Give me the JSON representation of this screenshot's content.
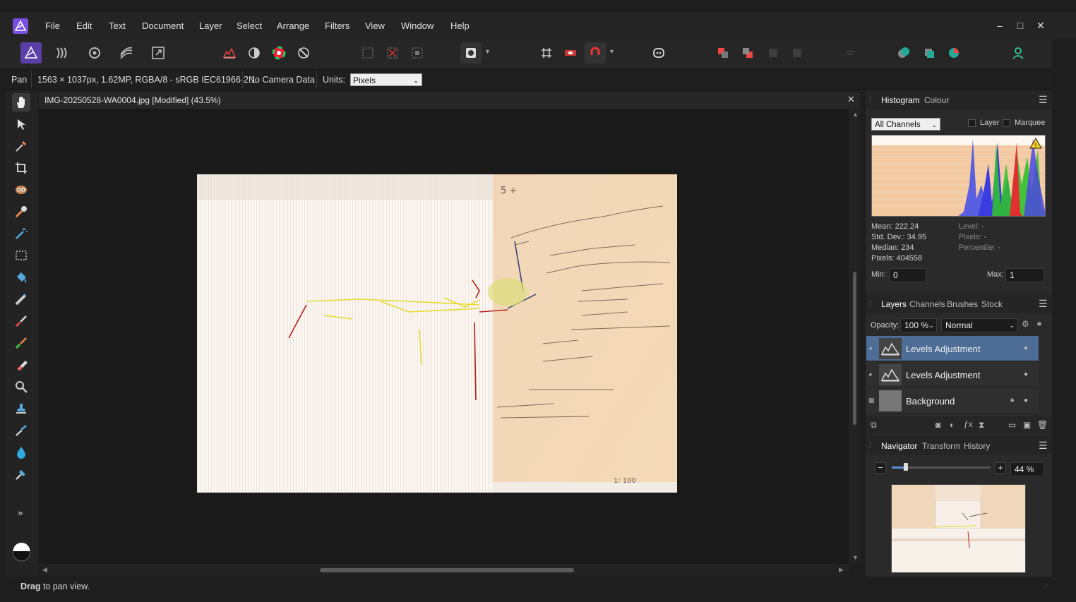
{
  "menu": [
    "File",
    "Edit",
    "Text",
    "Document",
    "Layer",
    "Select",
    "Arrange",
    "Filters",
    "View",
    "Window",
    "Help"
  ],
  "window_controls": {
    "minimize": "–",
    "maximize": "□",
    "close": "✕"
  },
  "context_bar": {
    "tool": "Pan",
    "info": "1563 × 1037px, 1.62MP, RGBA/8 - sRGB IEC61966-2.1",
    "camera": "No Camera Data",
    "units_label": "Units:",
    "units_value": "Pixels"
  },
  "document": {
    "title": "IMG-20250528-WA0004.jpg [Modified] (43.5%)",
    "close": "✕"
  },
  "histogram_panel": {
    "tabs": [
      "Histogram",
      "Colour"
    ],
    "channel_select": "All Channels",
    "checkbox_layer": "Layer",
    "checkbox_marquee": "Marquee",
    "stats": {
      "mean": "Mean: 222.24",
      "std_dev": "Std. Dev.: 34.95",
      "median": "Median: 234",
      "pixels": "Pixels: 404558",
      "level": "Level: -",
      "pixels_right": "Pixels: -",
      "percentile": "Percentile: -"
    },
    "min_label": "Min:",
    "min_value": "0",
    "max_label": "Max:",
    "max_value": "1"
  },
  "layers_panel": {
    "tabs": [
      "Layers",
      "Channels",
      "Brushes",
      "Stock"
    ],
    "opacity_label": "Opacity:",
    "opacity_value": "100 %",
    "blend_mode": "Normal",
    "layers": [
      {
        "name": "Levels Adjustment",
        "selected": true
      },
      {
        "name": "Levels Adjustment",
        "selected": false
      },
      {
        "name": "Background",
        "selected": false,
        "locked": true
      }
    ]
  },
  "navigator_panel": {
    "tabs": [
      "Navigator",
      "Transform",
      "History"
    ],
    "zoom_value": "44 %",
    "zoom_minus": "−",
    "zoom_plus": "+"
  },
  "status": {
    "bold": "Drag",
    "rest": " to pan view."
  },
  "colors": {
    "accent": "#4d6c96",
    "logo": "#8b5cf6"
  }
}
